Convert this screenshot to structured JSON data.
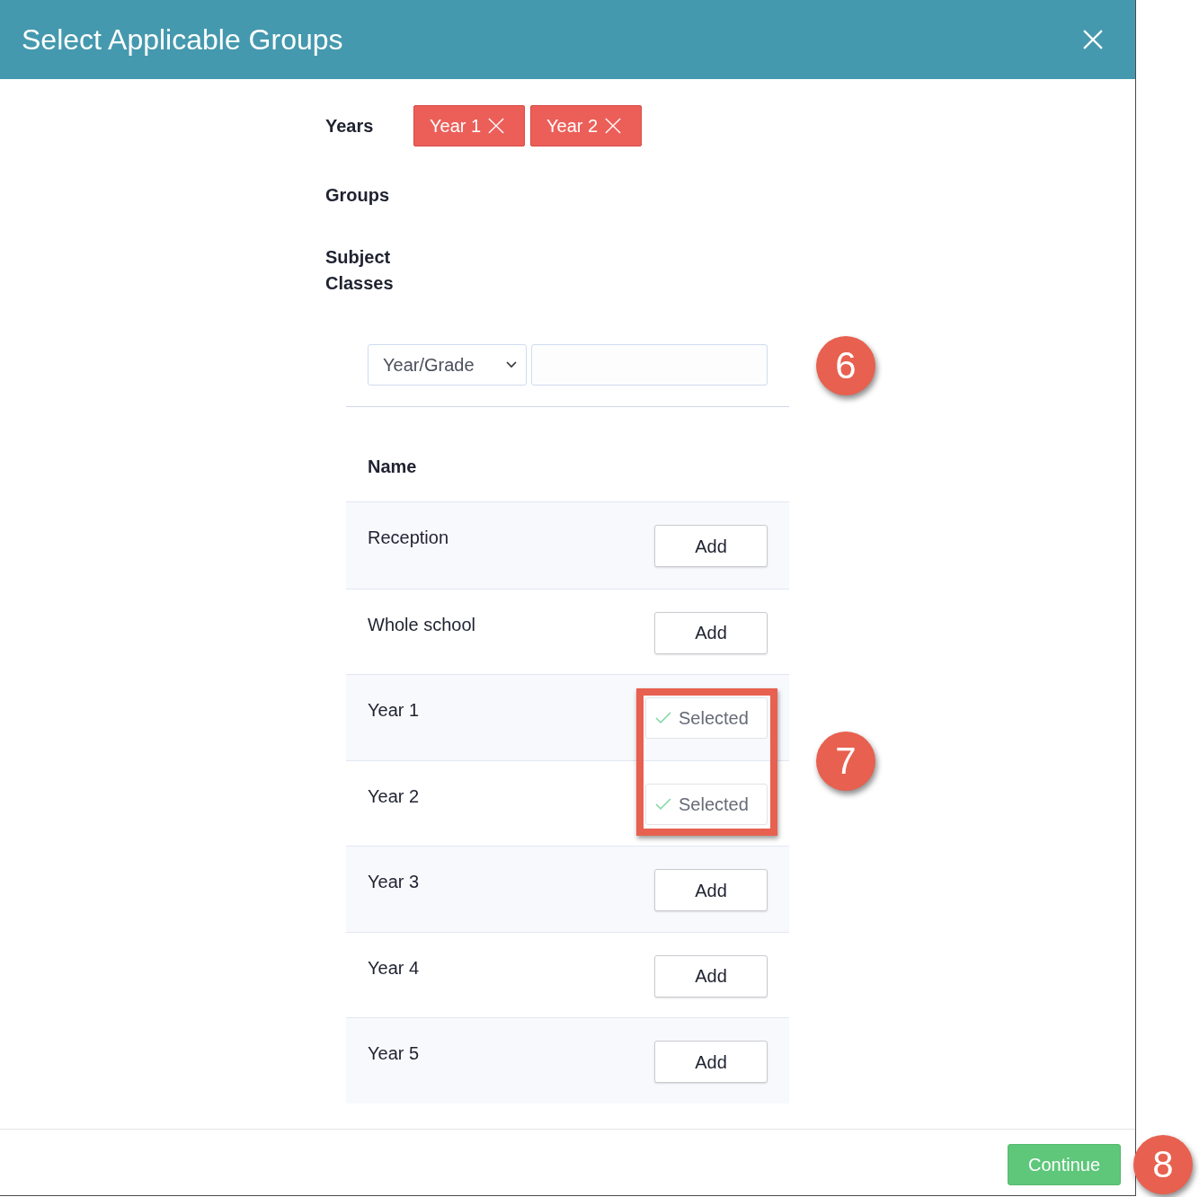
{
  "dialog": {
    "title": "Select Applicable Groups"
  },
  "fields": [
    {
      "label": "Years",
      "chips": [
        {
          "label": "Year 1"
        },
        {
          "label": "Year 2"
        }
      ]
    },
    {
      "label": "Groups"
    },
    {
      "label": "Subject Classes"
    }
  ],
  "filter": {
    "select": {
      "value": "Year/Grade"
    },
    "marker": "6"
  },
  "table": {
    "columns": [
      "Name"
    ],
    "rows": [
      {
        "name": "Reception",
        "action": "Add",
        "selected": false,
        "highlighted": false
      },
      {
        "name": "Whole school",
        "action": "Add",
        "selected": false,
        "highlighted": false
      },
      {
        "name": "Year 1",
        "action": "Selected",
        "selected": true,
        "highlighted": true
      },
      {
        "name": "Year 2",
        "action": "Selected",
        "selected": true,
        "highlighted": true
      },
      {
        "name": "Year 3",
        "action": "Add",
        "selected": false,
        "highlighted": false
      },
      {
        "name": "Year 4",
        "action": "Add",
        "selected": false,
        "highlighted": false
      },
      {
        "name": "Year 5",
        "action": "Add",
        "selected": false,
        "highlighted": false
      }
    ],
    "marker": "7"
  },
  "footer": {
    "button": "Continue",
    "marker": "8"
  }
}
